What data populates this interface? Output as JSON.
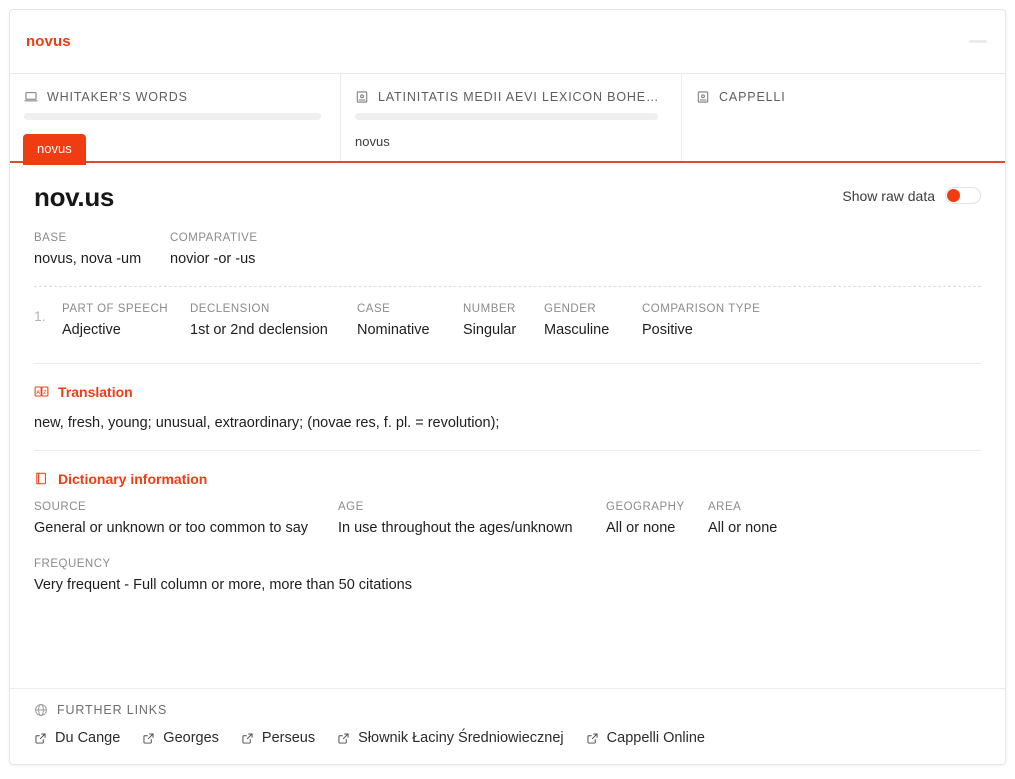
{
  "window": {
    "title": "novus",
    "accent_color": "#ef3c13",
    "collapse_control": "collapse-handle"
  },
  "dictionary_tabs": [
    {
      "label": "WHITAKER'S WORDS",
      "icon": "laptop-icon",
      "loading_bar": true,
      "chip": "novus",
      "chip_active": true
    },
    {
      "label": "LATINITATIS MEDII AEVI LEXICON BOHE…",
      "icon": "book-icon",
      "loading_bar": true,
      "chip": "novus",
      "chip_active": false
    },
    {
      "label": "CAPPELLI",
      "icon": "book-icon",
      "loading_bar": false,
      "chip": "",
      "chip_active": false
    }
  ],
  "entry": {
    "title": "nov.us",
    "raw_data_toggle": {
      "label": "Show raw data",
      "state": "off",
      "knob_color": "#f03c12"
    },
    "forms": [
      {
        "label": "BASE",
        "value": "novus, nova -um"
      },
      {
        "label": "COMPARATIVE",
        "value": "novior -or -us"
      }
    ],
    "analyses": [
      {
        "index": "1.",
        "fields": [
          {
            "label": "PART OF SPEECH",
            "value": "Adjective"
          },
          {
            "label": "DECLENSION",
            "value": "1st or 2nd declension"
          },
          {
            "label": "CASE",
            "value": "Nominative"
          },
          {
            "label": "NUMBER",
            "value": "Singular"
          },
          {
            "label": "GENDER",
            "value": "Masculine"
          },
          {
            "label": "COMPARISON TYPE",
            "value": "Positive"
          }
        ]
      }
    ],
    "translation": {
      "icon": "translate-icon",
      "title": "Translation",
      "text": "new, fresh, young; unusual, extraordinary; (novae res, f. pl. = revolution);"
    },
    "dictionary_information": {
      "icon": "book-outline-icon",
      "title": "Dictionary information",
      "row1": [
        {
          "label": "SOURCE",
          "value": "General or unknown or too common to say"
        },
        {
          "label": "AGE",
          "value": "In use throughout the ages/unknown"
        },
        {
          "label": "GEOGRAPHY",
          "value": "All or none"
        },
        {
          "label": "AREA",
          "value": "All or none"
        }
      ],
      "row2": [
        {
          "label": "FREQUENCY",
          "value": "Very frequent - Full column or more, more than 50 citations"
        }
      ]
    }
  },
  "further_links": {
    "icon": "globe-icon",
    "label": "FURTHER LINKS",
    "items": [
      {
        "label": "Du Cange",
        "icon": "external-link-icon"
      },
      {
        "label": "Georges",
        "icon": "external-link-icon"
      },
      {
        "label": "Perseus",
        "icon": "external-link-icon"
      },
      {
        "label": "Słownik Łaciny Średniowiecznej",
        "icon": "external-link-icon"
      },
      {
        "label": "Cappelli Online",
        "icon": "external-link-icon"
      }
    ]
  }
}
